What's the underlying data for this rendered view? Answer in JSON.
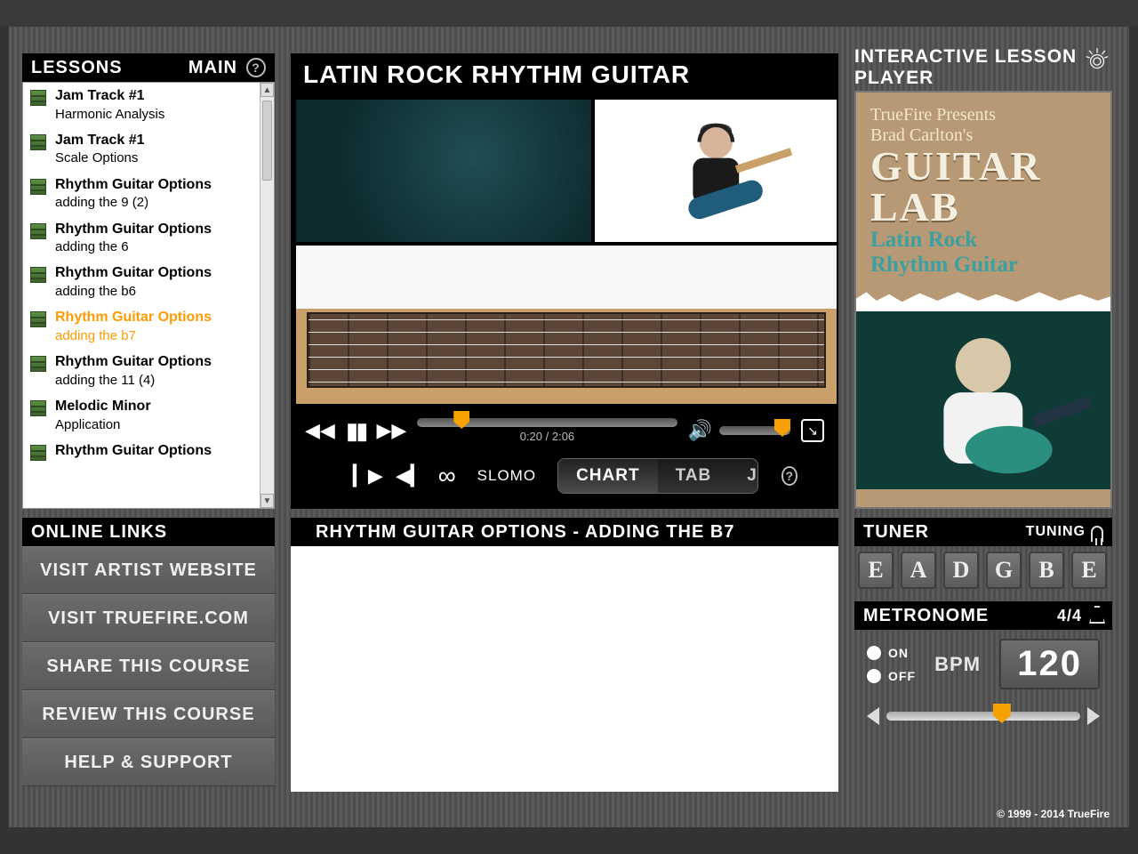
{
  "lessons": {
    "header": "LESSONS",
    "main_label": "MAIN",
    "items": [
      {
        "title": "Jam Track #1",
        "sub": "Harmonic Analysis",
        "active": ""
      },
      {
        "title": "Jam Track #1",
        "sub": "Scale Options",
        "active": ""
      },
      {
        "title": "Rhythm Guitar Options",
        "sub": "adding the 9 (2)",
        "active": ""
      },
      {
        "title": "Rhythm Guitar Options",
        "sub": "adding the 6",
        "active": ""
      },
      {
        "title": "Rhythm Guitar Options",
        "sub": "adding the b6",
        "active": ""
      },
      {
        "title": "Rhythm Guitar Options",
        "sub": "adding the b7",
        "active": "active"
      },
      {
        "title": "Rhythm Guitar Options",
        "sub": "adding the 11 (4)",
        "active": ""
      },
      {
        "title": "Melodic Minor",
        "sub": "Application",
        "active": ""
      },
      {
        "title": "Rhythm Guitar Options",
        "sub": "",
        "active": ""
      }
    ]
  },
  "video": {
    "title": "LATIN ROCK RHYTHM GUITAR",
    "time": "0:20 / 2:06",
    "slomo": "SLOMO",
    "tabs": {
      "chart": "CHART",
      "tab": "TAB",
      "jam": "JAM"
    }
  },
  "player_title": "INTERACTIVE LESSON PLAYER",
  "promo": {
    "line1": "TrueFire Presents",
    "line2": "Brad Carlton's",
    "big1": "GUITAR",
    "big2": "LAB",
    "sub1": "Latin Rock",
    "sub2": "Rhythm Guitar"
  },
  "links": {
    "header": "ONLINE LINKS",
    "items": [
      "VISIT ARTIST WEBSITE",
      "VISIT TRUEFIRE.COM",
      "SHARE THIS COURSE",
      "REVIEW THIS COURSE",
      "HELP & SUPPORT"
    ]
  },
  "chart": {
    "title": "RHYTHM GUITAR OPTIONS - ADDING THE B7"
  },
  "tuner": {
    "header": "TUNER",
    "tuning_label": "TUNING",
    "notes": [
      "E",
      "A",
      "D",
      "G",
      "B",
      "E"
    ]
  },
  "metronome": {
    "header": "METRONOME",
    "timesig": "4/4",
    "on": "ON",
    "off": "OFF",
    "bpm_label": "BPM",
    "bpm": "120"
  },
  "copyright": "© 1999 - 2014 TrueFire"
}
